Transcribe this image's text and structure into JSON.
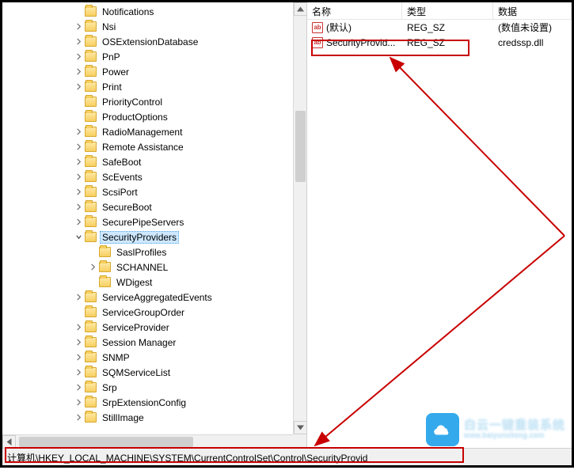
{
  "tree": {
    "items": [
      {
        "indent": 5,
        "exp": null,
        "label": "Notifications"
      },
      {
        "indent": 5,
        "exp": "closed",
        "label": "Nsi"
      },
      {
        "indent": 5,
        "exp": "closed",
        "label": "OSExtensionDatabase"
      },
      {
        "indent": 5,
        "exp": "closed",
        "label": "PnP"
      },
      {
        "indent": 5,
        "exp": "closed",
        "label": "Power"
      },
      {
        "indent": 5,
        "exp": "closed",
        "label": "Print"
      },
      {
        "indent": 5,
        "exp": null,
        "label": "PriorityControl"
      },
      {
        "indent": 5,
        "exp": null,
        "label": "ProductOptions"
      },
      {
        "indent": 5,
        "exp": "closed",
        "label": "RadioManagement"
      },
      {
        "indent": 5,
        "exp": "closed",
        "label": "Remote Assistance"
      },
      {
        "indent": 5,
        "exp": "closed",
        "label": "SafeBoot"
      },
      {
        "indent": 5,
        "exp": "closed",
        "label": "ScEvents"
      },
      {
        "indent": 5,
        "exp": "closed",
        "label": "ScsiPort"
      },
      {
        "indent": 5,
        "exp": "closed",
        "label": "SecureBoot"
      },
      {
        "indent": 5,
        "exp": "closed",
        "label": "SecurePipeServers"
      },
      {
        "indent": 5,
        "exp": "open",
        "label": "SecurityProviders",
        "selected": true
      },
      {
        "indent": 6,
        "exp": null,
        "label": "SaslProfiles"
      },
      {
        "indent": 6,
        "exp": "closed",
        "label": "SCHANNEL"
      },
      {
        "indent": 6,
        "exp": null,
        "label": "WDigest"
      },
      {
        "indent": 5,
        "exp": "closed",
        "label": "ServiceAggregatedEvents"
      },
      {
        "indent": 5,
        "exp": null,
        "label": "ServiceGroupOrder"
      },
      {
        "indent": 5,
        "exp": "closed",
        "label": "ServiceProvider"
      },
      {
        "indent": 5,
        "exp": "closed",
        "label": "Session Manager"
      },
      {
        "indent": 5,
        "exp": "closed",
        "label": "SNMP"
      },
      {
        "indent": 5,
        "exp": "closed",
        "label": "SQMServiceList"
      },
      {
        "indent": 5,
        "exp": "closed",
        "label": "Srp"
      },
      {
        "indent": 5,
        "exp": "closed",
        "label": "SrpExtensionConfig"
      },
      {
        "indent": 5,
        "exp": "closed",
        "label": "StillImage"
      }
    ]
  },
  "list": {
    "columns": {
      "name": "名称",
      "type": "类型",
      "data": "数据"
    },
    "rows": [
      {
        "name": "(默认)",
        "type": "REG_SZ",
        "data": "(数值未设置)",
        "highlight": false
      },
      {
        "name": "SecurityProvid...",
        "type": "REG_SZ",
        "data": "credssp.dll",
        "highlight": true
      }
    ]
  },
  "status": {
    "path": "计算机\\HKEY_LOCAL_MACHINE\\SYSTEM\\CurrentControlSet\\Control\\SecurityProvid"
  },
  "watermark": {
    "line1": "白云一键重装系统",
    "line2": "www.baiyunxitong.com"
  },
  "icons": {
    "ab": "ab"
  }
}
